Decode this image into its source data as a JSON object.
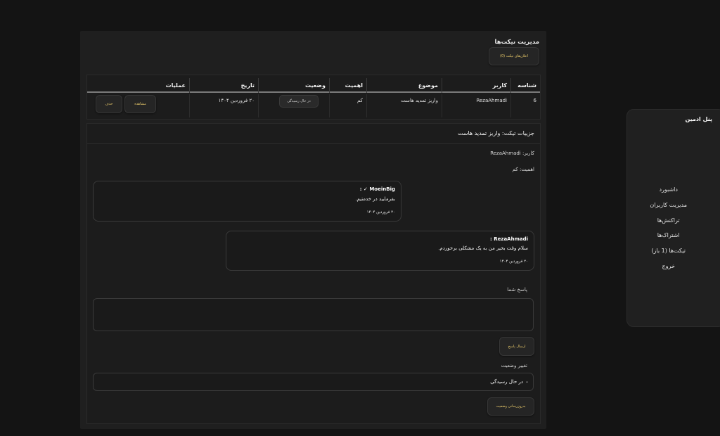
{
  "sidebar": {
    "title": "پنل ادمین",
    "items": [
      {
        "label": "داشبورد"
      },
      {
        "label": "مدیریت کاربران"
      },
      {
        "label": "تراکنش‌ها"
      },
      {
        "label": "اشتراک‌ها"
      },
      {
        "label": "تیکت‌ها (1 باز)"
      },
      {
        "label": "خروج"
      }
    ]
  },
  "page": {
    "title": "مدیریت تیکت‌ها",
    "notif_button": "اعلان‌های تیکت (0)"
  },
  "table": {
    "headers": {
      "id": "شناسه",
      "user": "کاربر",
      "subject": "موضوع",
      "priority": "اهمیت",
      "status": "وضعیت",
      "date": "تاریخ",
      "actions": "عملیات"
    },
    "row": {
      "id": "6",
      "user": "RezaAhmadi",
      "subject": "واریز تمدید هاست",
      "priority": "کم",
      "status": "در حال رسیدگی",
      "date": "۲۰ فروردین ۱۴۰۴",
      "view_label": "مشاهده",
      "delete_label": "حذف"
    }
  },
  "details": {
    "title": "جزییات تیکت: واریز تمدید هاست",
    "user_line": "کاربر: RezaAhmadi",
    "priority_line": "اهمیت: کم",
    "messages": [
      {
        "author": "MoeinBig ✓ :",
        "text": "بفرمایید در خدمتیم.",
        "date": "۲۰ فروردین ۱۴۰۴"
      },
      {
        "author": "RezaAhmadi :",
        "text": "سلام وقت بخیر من به یک مشکلی برخوردم.",
        "date": "۲۰ فروردین ۱۴۰۴"
      }
    ],
    "reply_label": "پاسخ شما",
    "send_button": "ارسال پاسخ",
    "status_change_label": "تغییر وضعیت",
    "status_selected": "در حال رسیدگی",
    "update_status_button": "به‌روزرسانی وضعیت"
  },
  "colors": {
    "accent": "#e8c96a",
    "background": "#141414",
    "panel": "#1f1f1f"
  }
}
